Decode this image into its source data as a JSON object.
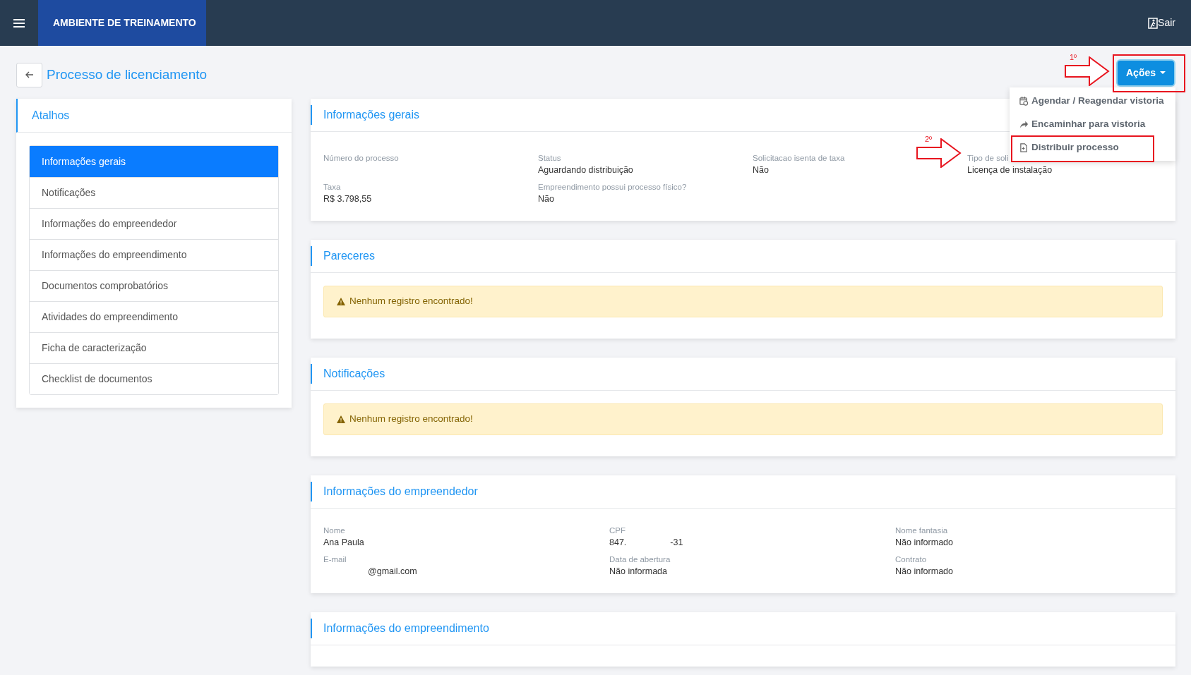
{
  "top_bar": {
    "environment": "AMBIENTE DE TREINAMENTO",
    "logout": "Sair"
  },
  "page": {
    "title": "Processo de licenciamento"
  },
  "actions": {
    "label": "Ações",
    "expanded": true,
    "menu": [
      {
        "kind": "calendar",
        "label": "Agendar / Reagendar vistoria"
      },
      {
        "kind": "forward",
        "label": "Encaminhar para vistoria"
      },
      {
        "kind": "file",
        "label": "Distribuir processo"
      }
    ]
  },
  "annotations": [
    {
      "label": "1º"
    },
    {
      "label": "2º"
    }
  ],
  "shortcuts": {
    "title": "Atalhos",
    "items": [
      {
        "label": "Informações gerais",
        "selected": true
      },
      {
        "label": "Notificações",
        "selected": false
      },
      {
        "label": "Informações do empreendedor",
        "selected": false
      },
      {
        "label": "Informações do empreendimento",
        "selected": false
      },
      {
        "label": "Documentos comprobatórios",
        "selected": false
      },
      {
        "label": "Atividades do empreendimento",
        "selected": false
      },
      {
        "label": "Ficha de caracterização",
        "selected": false
      },
      {
        "label": "Checklist de documentos",
        "selected": false
      }
    ]
  },
  "sections": [
    {
      "kind": "fields_wide",
      "title": "Informações gerais",
      "fields": [
        {
          "label": "Número do processo"
        },
        {
          "label": "Status",
          "value": "Aguardando distribuição"
        },
        {
          "label": "Solicitacao isenta de taxa",
          "value": "Não"
        },
        {
          "label": "Tipo de soli",
          "value": "Licença de instalação"
        },
        {
          "label": "Taxa",
          "value": "R$ 3.798,55"
        },
        {
          "label": "Empreendimento possui processo físico?",
          "value": "Não"
        }
      ]
    },
    {
      "kind": "alert",
      "title": "Pareceres",
      "message": "Nenhum registro encontrado!"
    },
    {
      "kind": "alert",
      "title": "Notificações",
      "message": "Nenhum registro encontrado!"
    },
    {
      "kind": "fields",
      "title": "Informações do empreendedor",
      "fields": [
        {
          "label": "Nome",
          "value": "Ana Paula"
        },
        {
          "label": "CPF",
          "value_parts": [
            "847.",
            "-31"
          ]
        },
        {
          "label": "Nome fantasia",
          "value": "Não informado"
        },
        {
          "label": "E-mail",
          "value": "@gmail.com",
          "redacted_prefix": true
        },
        {
          "label": "Data de abertura",
          "value": "Não informada"
        },
        {
          "label": "Contrato",
          "value": "Não informado"
        }
      ]
    },
    {
      "kind": "empty",
      "title": "Informações do empreendimento"
    }
  ]
}
